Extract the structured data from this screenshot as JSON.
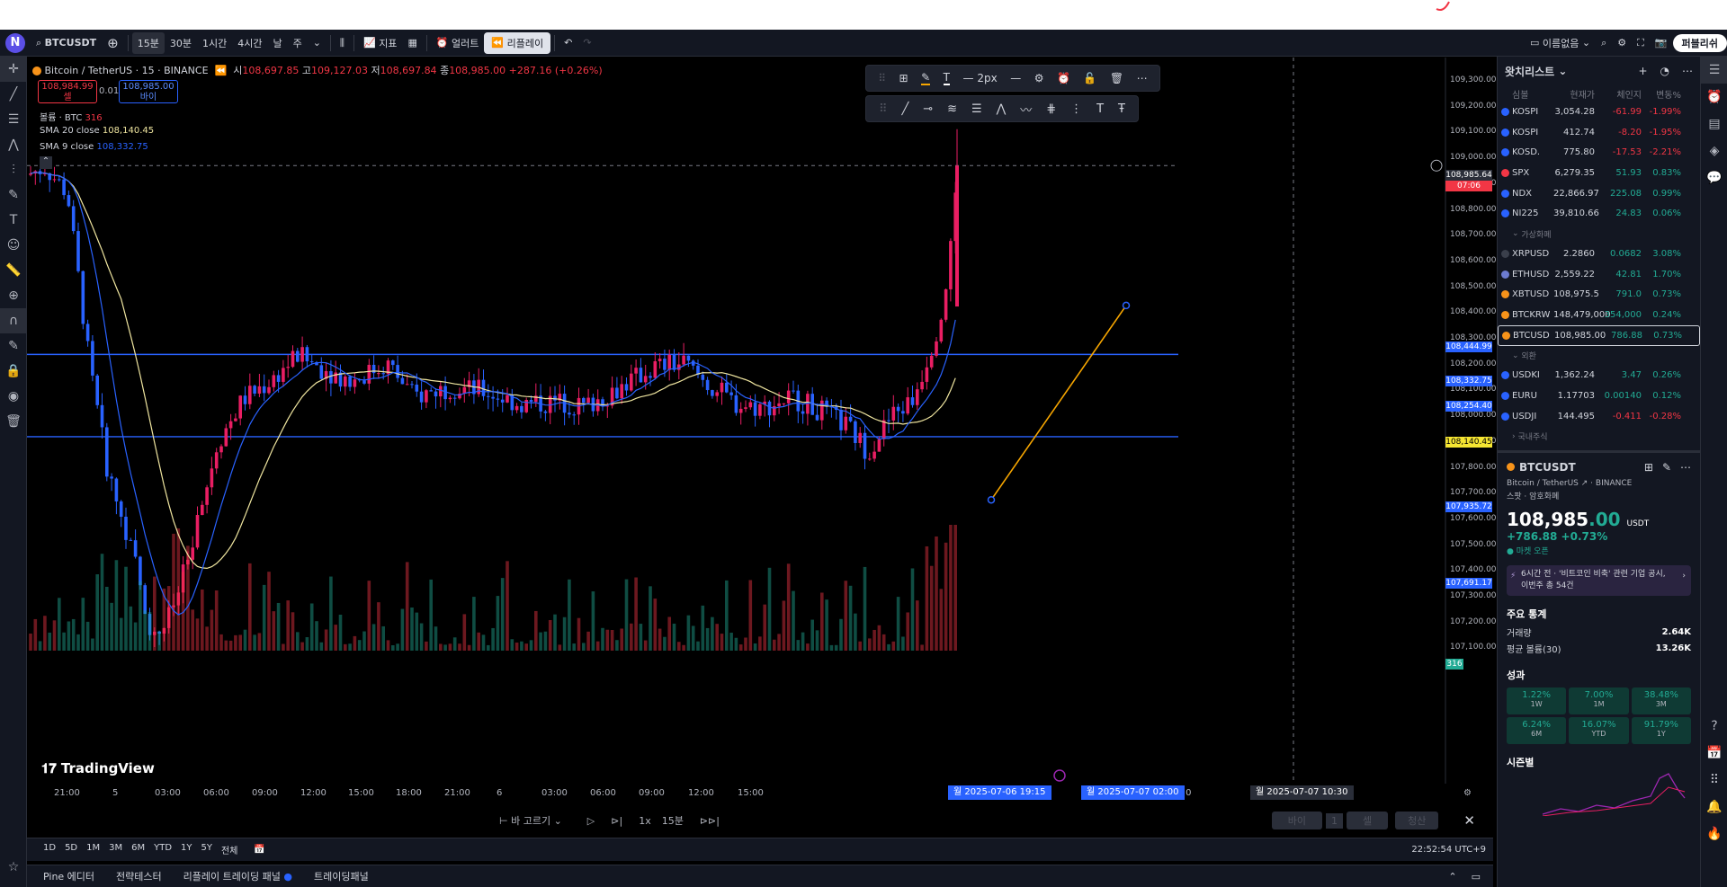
{
  "toolbar": {
    "logo": "N",
    "symbol": "BTCUSDT",
    "intervals": [
      "15분",
      "30분",
      "1시간",
      "4시간",
      "날",
      "주"
    ],
    "active_interval": "15분",
    "indicators_label": "지표",
    "alert_label": "얼러트",
    "replay_label": "리플레이",
    "layout_name": "이름없음",
    "publish_label": "퍼블리쉬"
  },
  "legend": {
    "title": "Bitcoin / TetherUS · 15 · BINANCE",
    "open_label": "시",
    "open": "108,697.85",
    "high_label": "고",
    "high": "109,127.03",
    "low_label": "저",
    "low": "108,697.84",
    "close_label": "종",
    "close": "108,985.00",
    "change": "+287.16 (+0.26%)",
    "sell_price": "108,984.99",
    "sell_label": "셀",
    "spread": "0.01",
    "buy_price": "108,985.00",
    "buy_label": "바이",
    "volume": "볼륨 · BTC",
    "volume_val": "316",
    "sma20": "SMA 20 close",
    "sma20_val": "108,140.45",
    "sma9": "SMA 9 close",
    "sma9_val": "108,332.75"
  },
  "drawing_toolbar": {
    "width_label": "2px"
  },
  "price_scale": {
    "labels": [
      "109,300.00",
      "109,200.00",
      "109,100.00",
      "109,000.00",
      "108,900.00",
      "108,800.00",
      "108,700.00",
      "108,600.00",
      "108,500.00",
      "108,400.00",
      "108,300.00",
      "108,200.00",
      "108,100.00",
      "108,000.00",
      "107,900.00",
      "107,800.00",
      "107,700.00",
      "107,600.00",
      "107,500.00",
      "107,400.00",
      "107,300.00",
      "107,200.00",
      "107,100.00"
    ],
    "crosshair_price": "108,985.64",
    "countdown": "07:06",
    "tag_444": "108,444.99",
    "tag_332": "108,332.75",
    "tag_254": "108,254.40",
    "tag_140": "108,140.45",
    "tag_935": "107,935.72",
    "tag_691": "107,691.17",
    "volume_tag": "316"
  },
  "time_scale": {
    "labels": [
      "21:00",
      "5",
      "03:00",
      "06:00",
      "09:00",
      "12:00",
      "15:00",
      "18:00",
      "21:00",
      "6",
      "03:00",
      "06:00",
      "09:00",
      "12:00",
      "15:00",
      "06:00",
      "15:00",
      "18:0"
    ],
    "range_start": "월 2025-07-06  19:15",
    "range_end": "월 2025-07-07  02:00",
    "crosshair_time": "월 2025-07-07  10:30"
  },
  "replay_bar": {
    "select_bar": "바 고르기",
    "speed": "1x",
    "interval": "15분",
    "buy": "바이",
    "qty": "1",
    "sell": "셀",
    "close": "청산"
  },
  "ranges": [
    "1D",
    "5D",
    "1M",
    "3M",
    "6M",
    "YTD",
    "1Y",
    "5Y",
    "전체"
  ],
  "clock": "22:52:54 UTC+9",
  "bottom_tabs": [
    "Pine 에디터",
    "전략테스터",
    "리플레이 트레이딩 패널",
    "트레이딩패널"
  ],
  "watermark": "TradingView",
  "watchlist": {
    "title": "왓치리스트",
    "cols": [
      "심볼",
      "현재가",
      "체인지",
      "변동%"
    ],
    "rows": [
      {
        "sym": "KOSPI",
        "last": "3,054.28",
        "chg": "-61.99",
        "pct": "-1.99%",
        "color": "#2962ff",
        "neg": true
      },
      {
        "sym": "KOSPI",
        "last": "412.74",
        "chg": "-8.20",
        "pct": "-1.95%",
        "color": "#2962ff",
        "neg": true
      },
      {
        "sym": "KOSD.",
        "last": "775.80",
        "chg": "-17.53",
        "pct": "-2.21%",
        "color": "#2962ff",
        "neg": true
      },
      {
        "sym": "SPX",
        "last": "6,279.35",
        "chg": "51.93",
        "pct": "0.83%",
        "color": "#f23645",
        "neg": false
      },
      {
        "sym": "NDX",
        "last": "22,866.97",
        "chg": "225.08",
        "pct": "0.99%",
        "color": "#2962ff",
        "neg": false
      },
      {
        "sym": "NI225",
        "last": "39,810.66",
        "chg": "24.83",
        "pct": "0.06%",
        "color": "#2962ff",
        "neg": false
      }
    ],
    "section_crypto": "가상화폐",
    "crypto": [
      {
        "sym": "XRPUSD",
        "last": "2.2860",
        "chg": "0.0682",
        "pct": "3.08%",
        "color": "#3a3f4b"
      },
      {
        "sym": "ETHUSD",
        "last": "2,559.22",
        "chg": "42.81",
        "pct": "1.70%",
        "color": "#6c7bd1"
      },
      {
        "sym": "XBTUSD",
        "last": "108,975.5",
        "chg": "791.0",
        "pct": "0.73%",
        "color": "#f7931a"
      },
      {
        "sym": "BTCKRW",
        "last": "148,479,000",
        "chg": "354,000",
        "pct": "0.24%",
        "color": "#f7931a"
      },
      {
        "sym": "BTCUSD",
        "last": "108,985.00",
        "chg": "786.88",
        "pct": "0.73%",
        "color": "#f7931a"
      }
    ],
    "section_fx": "외환",
    "fx": [
      {
        "sym": "USDKI",
        "last": "1,362.24",
        "chg": "3.47",
        "pct": "0.26%",
        "color": "#2962ff",
        "neg": false
      },
      {
        "sym": "EURU",
        "last": "1.17703",
        "chg": "0.00140",
        "pct": "0.12%",
        "color": "#2962ff",
        "neg": false
      },
      {
        "sym": "USDJI",
        "last": "144.495",
        "chg": "-0.411",
        "pct": "-0.28%",
        "color": "#2962ff",
        "neg": true
      }
    ],
    "section_kr": "국내주식"
  },
  "detail": {
    "symbol": "BTCUSDT",
    "name": "Bitcoin / TetherUS",
    "exchange": "BINANCE",
    "type": "스팟 · 암호화폐",
    "price_main": "108,985",
    "price_dec": ".00",
    "currency": "USDT",
    "change": "+786.88 +0.73%",
    "market": "마켓 오픈",
    "news": "6시간 전 · '비트코인 비축' 관련 기업 공시, 이번주 총 54건",
    "stats_title": "주요 통계",
    "vol_label": "거래량",
    "vol": "2.64K",
    "avgvol_label": "평균 볼륨(30)",
    "avgvol": "13.26K",
    "perf_title": "성과",
    "perf": [
      {
        "v": "1.22%",
        "p": "1W"
      },
      {
        "v": "7.00%",
        "p": "1M"
      },
      {
        "v": "38.48%",
        "p": "3M"
      },
      {
        "v": "6.24%",
        "p": "6M"
      },
      {
        "v": "16.07%",
        "p": "YTD"
      },
      {
        "v": "91.79%",
        "p": "1Y"
      }
    ],
    "season_title": "시즌별"
  }
}
